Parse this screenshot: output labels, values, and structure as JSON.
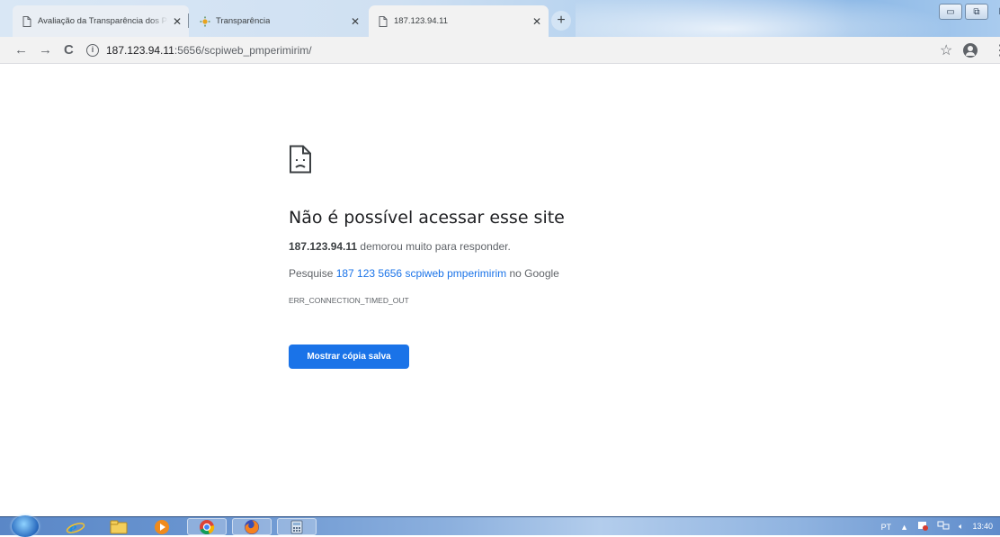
{
  "tabs": [
    {
      "title": "Avaliação da Transparência dos Portais",
      "icon": "document-icon"
    },
    {
      "title": "Transparência",
      "icon": "sun-logo-icon"
    },
    {
      "title": "187.123.94.11",
      "icon": "document-icon"
    }
  ],
  "toolbar": {
    "url_host": "187.123.94.11",
    "url_path": ":5656/scpiweb_pmperimirim/"
  },
  "error": {
    "heading": "Não é possível acessar esse site",
    "host": "187.123.94.11",
    "timeout_text": " demorou muito para responder.",
    "search_prefix": "Pesquise ",
    "search_link": "187 123 5656 scpiweb pmperimirim",
    "search_suffix": " no Google",
    "code": "ERR_CONNECTION_TIMED_OUT",
    "button_label": "Mostrar cópia salva"
  },
  "taskbar": {
    "apps": [
      "internet-explorer-icon",
      "file-explorer-icon",
      "media-player-icon",
      "chrome-icon",
      "firefox-icon",
      "calculator-icon"
    ],
    "language": "PT",
    "time": "13:40"
  },
  "colors": {
    "link_blue": "#1a73e8",
    "button_blue": "#1a73e8"
  }
}
